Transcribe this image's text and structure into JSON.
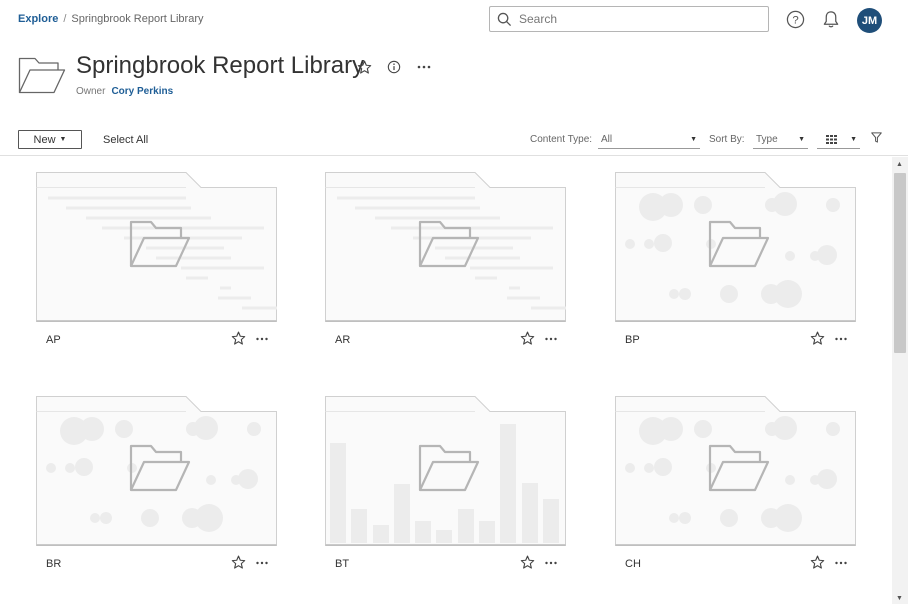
{
  "breadcrumb": {
    "root": "Explore",
    "separator": "/",
    "current": "Springbrook Report Library"
  },
  "search": {
    "placeholder": "Search"
  },
  "user": {
    "initials": "JM"
  },
  "project": {
    "title": "Springbrook Report Library",
    "owner_label": "Owner",
    "owner_name": "Cory Perkins"
  },
  "toolbar": {
    "new_label": "New",
    "select_all_label": "Select All",
    "content_type_label": "Content Type:",
    "content_type_value": "All",
    "sort_by_label": "Sort By:",
    "sort_by_value": "Type"
  },
  "cards": [
    {
      "name": "AP",
      "thumb": "lines"
    },
    {
      "name": "AR",
      "thumb": "lines"
    },
    {
      "name": "BP",
      "thumb": "bubbles"
    },
    {
      "name": "BR",
      "thumb": "bubbles"
    },
    {
      "name": "BT",
      "thumb": "bars"
    },
    {
      "name": "CH",
      "thumb": "bubbles"
    }
  ],
  "colors": {
    "accent": "#1f5e96",
    "avatar": "#1f4e79",
    "thumb_placeholder": "#e8e8e8"
  }
}
